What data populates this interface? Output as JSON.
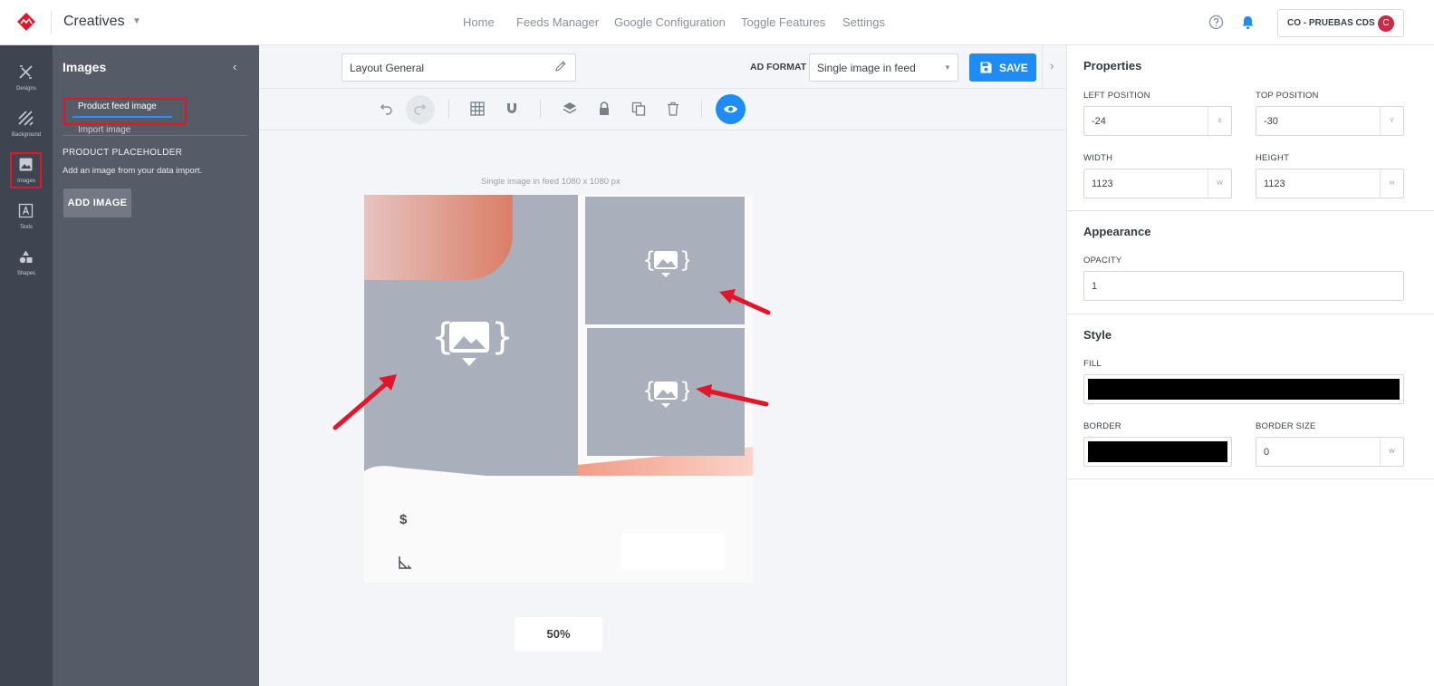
{
  "header": {
    "app_name": "Creatives",
    "nav": [
      "Home",
      "Feeds Manager",
      "Google Configuration",
      "Toggle Features",
      "Settings"
    ],
    "account_label": "CO - PRUEBAS CDS",
    "account_initial": "C",
    "brand_color": "#e3152b",
    "accent_color": "#1f8cf5"
  },
  "rail": {
    "items": [
      {
        "label": "Designs",
        "icon": "designs-icon"
      },
      {
        "label": "Background",
        "icon": "background-icon"
      },
      {
        "label": "Images",
        "icon": "image-icon"
      },
      {
        "label": "Texts",
        "icon": "text-icon"
      },
      {
        "label": "Shapes",
        "icon": "shapes-icon"
      }
    ]
  },
  "panel": {
    "title": "Images",
    "tabs": [
      "Product feed image",
      "Import image"
    ],
    "placeholder_title": "PRODUCT PLACEHOLDER",
    "placeholder_desc": "Add an image from your data import.",
    "add_button": "ADD IMAGE"
  },
  "editor": {
    "layout_name": "Layout General",
    "ad_format_label": "AD FORMAT",
    "ad_format_value": "Single image in feed",
    "save_label": "SAVE",
    "canvas_label": "Single image in feed 1080 x 1080 px",
    "price_symbol": "$",
    "zoom": "50%"
  },
  "properties": {
    "title": "Properties",
    "left_label": "LEFT POSITION",
    "left_value": "-24",
    "left_unit": "X",
    "top_label": "TOP POSITION",
    "top_value": "-30",
    "top_unit": "Y",
    "width_label": "WIDTH",
    "width_value": "1123",
    "width_unit": "W",
    "height_label": "HEIGHT",
    "height_value": "1123",
    "height_unit": "H",
    "appearance_title": "Appearance",
    "opacity_label": "OPACITY",
    "opacity_value": "1",
    "style_title": "Style",
    "fill_label": "FILL",
    "fill_color": "#000000",
    "border_label": "BORDER",
    "border_color": "#000000",
    "border_size_label": "BORDER SIZE",
    "border_size_value": "0",
    "border_size_unit": "W"
  }
}
